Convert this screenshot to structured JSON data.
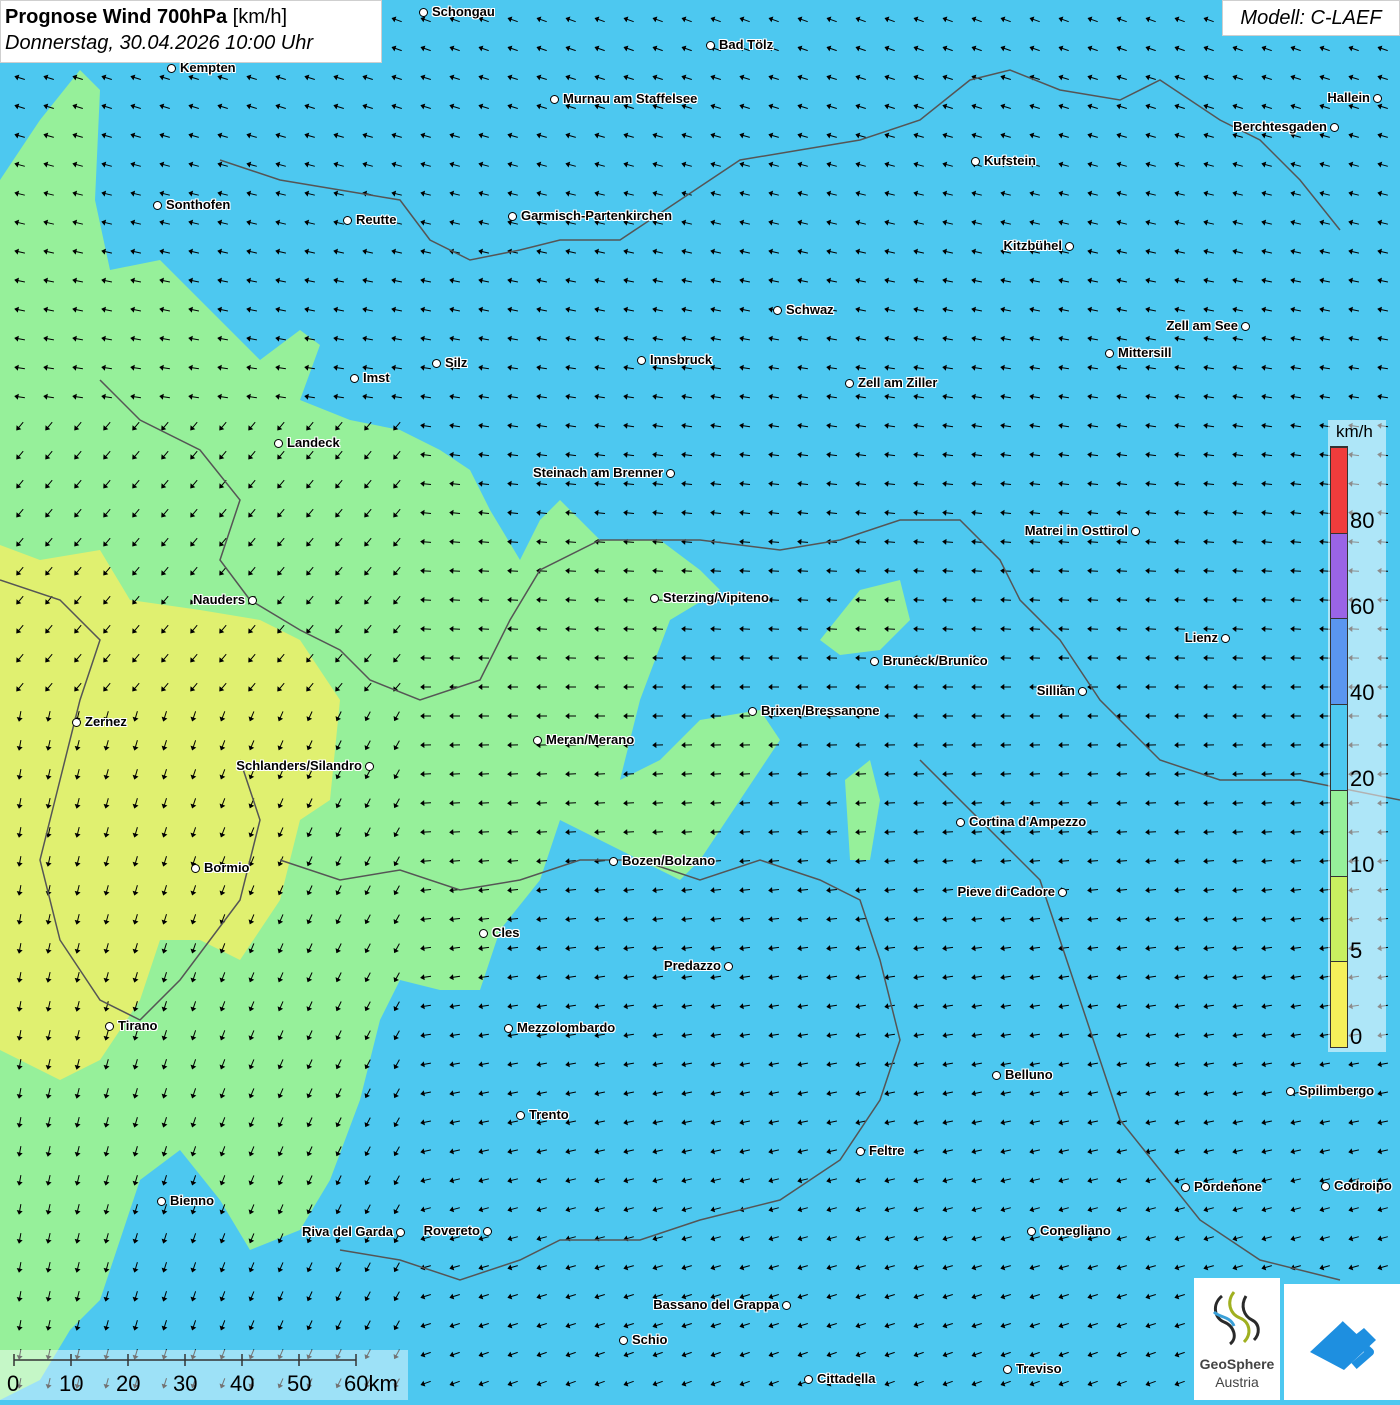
{
  "header": {
    "title_bold": "Prognose Wind 700hPa",
    "title_unit": " [km/h]",
    "datetime": "Donnerstag, 30.04.2026 10:00 Uhr",
    "model": "Modell: C-LAEF"
  },
  "legend": {
    "unit": "km/h",
    "labels": [
      "0",
      "5",
      "10",
      "20",
      "40",
      "60",
      "80"
    ],
    "colors": [
      "#f5f05a",
      "#c8f060",
      "#96f09a",
      "#4dc8f0",
      "#5a96f0",
      "#9a64e6",
      "#f03c3c"
    ]
  },
  "scale_bar": {
    "labels": [
      "0",
      "10",
      "20",
      "30",
      "40",
      "50",
      "60km"
    ]
  },
  "logos": {
    "geosphere_line1": "GeoSphere",
    "geosphere_line2": "Austria"
  },
  "cities": [
    {
      "name": "Schongau"
    },
    {
      "name": "Bad Tölz"
    },
    {
      "name": "Kempten"
    },
    {
      "name": "Murnau am Staffelsee"
    },
    {
      "name": "Hallein"
    },
    {
      "name": "Berchtesgaden"
    },
    {
      "name": "Kufstein"
    },
    {
      "name": "Sonthofen"
    },
    {
      "name": "Reutte"
    },
    {
      "name": "Garmisch-Partenkirchen"
    },
    {
      "name": "Kitzbühel"
    },
    {
      "name": "Schwaz"
    },
    {
      "name": "Zell am See"
    },
    {
      "name": "Mittersill"
    },
    {
      "name": "Imst"
    },
    {
      "name": "Silz"
    },
    {
      "name": "Innsbruck"
    },
    {
      "name": "Zell am Ziller"
    },
    {
      "name": "Landeck"
    },
    {
      "name": "Steinach am Brenner"
    },
    {
      "name": "Matrei in Osttirol"
    },
    {
      "name": "Nauders"
    },
    {
      "name": "Sterzing/Vipiteno"
    },
    {
      "name": "Lienz"
    },
    {
      "name": "Bruneck/Brunico"
    },
    {
      "name": "Sillian"
    },
    {
      "name": "Zernez"
    },
    {
      "name": "Brixen/Bressanone"
    },
    {
      "name": "Meran/Merano"
    },
    {
      "name": "Schlanders/Silandro"
    },
    {
      "name": "Cortina d'Ampezzo"
    },
    {
      "name": "Bozen/Bolzano"
    },
    {
      "name": "Bormio"
    },
    {
      "name": "Pieve di Cadore"
    },
    {
      "name": "Cles"
    },
    {
      "name": "Predazzo"
    },
    {
      "name": "Tirano"
    },
    {
      "name": "Mezzolombardo"
    },
    {
      "name": "Belluno"
    },
    {
      "name": "Spilimbergo"
    },
    {
      "name": "Trento"
    },
    {
      "name": "Feltre"
    },
    {
      "name": "Bienno"
    },
    {
      "name": "Pordenone"
    },
    {
      "name": "Codroipo"
    },
    {
      "name": "Riva del Garda"
    },
    {
      "name": "Rovereto"
    },
    {
      "name": "Conegliano"
    },
    {
      "name": "Bassano del Grappa"
    },
    {
      "name": "Schio"
    },
    {
      "name": "Treviso"
    },
    {
      "name": "Cittadella"
    }
  ]
}
